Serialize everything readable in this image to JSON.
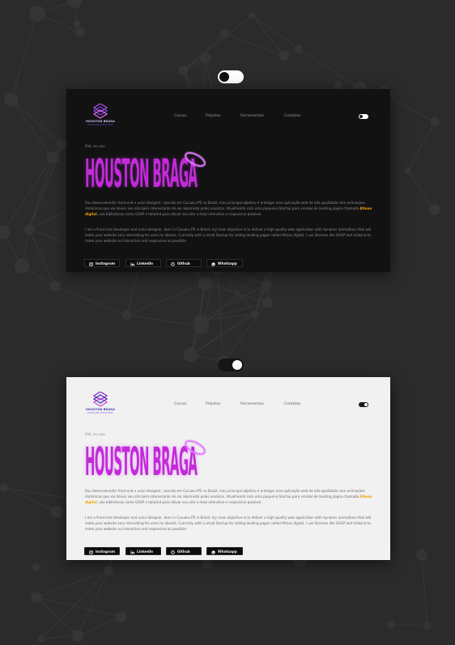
{
  "brand": {
    "name": "HOUSTON BRAGA",
    "tagline": "FRONT-END DEVELOPER"
  },
  "nav": {
    "items": [
      "Cursos",
      "Projetos",
      "Ferramentas",
      "Contatos"
    ]
  },
  "hero": {
    "greeting": "Olá, eu sou",
    "name": "HOUSTON BRAGA",
    "bio_pt_before": "Sou desenvolvedor front-end e ux/ui designer, nascido em Caruaru-PE no Brasil, meu principal objetivo é entregar uma aplicação web de alta qualidade com animações dinâmicas que vai deixar seu site bem interessante de ser absorvido pelos usuários. Atualmente com uma pequena Startup para vendas de landing pages chamada ",
    "bio_pt_highlight": "Afmoa digital",
    "bio_pt_after": ", uso bibliotecas como GSAP e tailwind para deixar seu site o mais interativo e responsivo possível.",
    "bio_en": "I am a Front-end developer and ux/ui designer, born in Caruaru-PE in Brazil, my main objective is to deliver a high quality web application with dynamic animations that will make your website very interesting for users to absorb. Currently with a small Startup for selling landing pages called Afmoa digital, I use libraries like GSAP and tailwind to make your website as interactive and responsive as possible."
  },
  "socials": [
    {
      "label": "Instagram",
      "icon": "instagram-icon"
    },
    {
      "label": "Linkedin",
      "icon": "linkedin-icon"
    },
    {
      "label": "Github",
      "icon": "github-icon"
    },
    {
      "label": "Whatsapp",
      "icon": "whatsapp-icon"
    }
  ],
  "colors": {
    "accent": "#c22bd8",
    "highlight": "#f0a400",
    "dark_card": "#121212",
    "light_card": "#f1f1f1",
    "page_background": "#2b2b2b"
  }
}
